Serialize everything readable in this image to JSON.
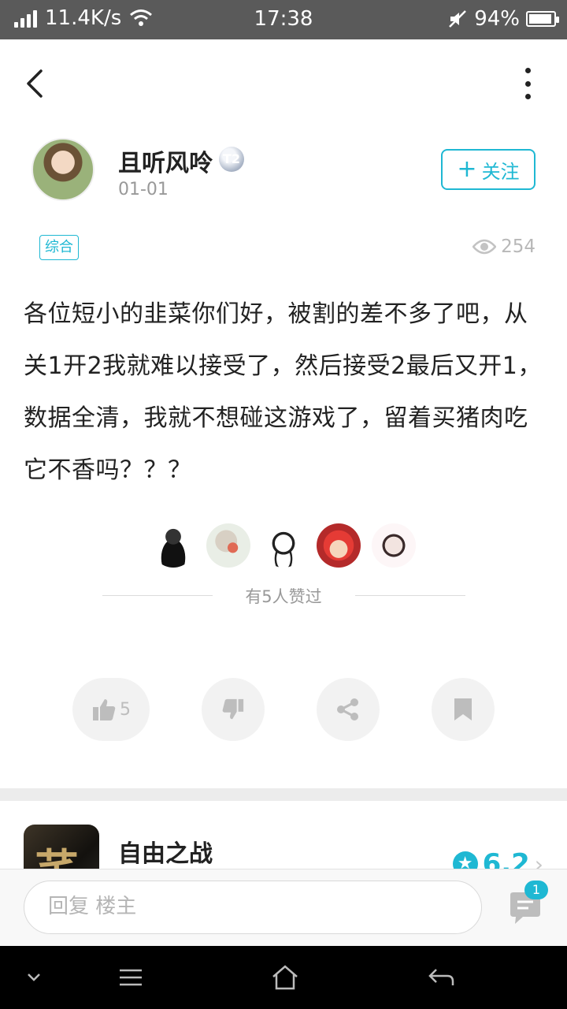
{
  "status_bar": {
    "network_speed": "11.4K/s",
    "time": "17:38",
    "battery_percent": "94%",
    "battery_level": 0.94
  },
  "author": {
    "name": "且听风呤",
    "level_badge": "T2",
    "date": "01-01",
    "follow_label": "关注",
    "follow_plus": "+"
  },
  "post": {
    "tag": "综合",
    "views": "254",
    "body": "各位短小的韭菜你们好，被割的差不多了吧，从关1开2我就难以接受了，然后接受2最后又开1，数据全清，我就不想碰这游戏了，留着买猪肉吃它不香吗？？？"
  },
  "likes": {
    "text": "有5人赞过",
    "count_label": "5"
  },
  "game": {
    "name": "自由之战",
    "score": "6.2"
  },
  "reply": {
    "placeholder": "回复  楼主",
    "comment_count": "1"
  },
  "colors": {
    "accent": "#1fb8d3",
    "status_bar_bg": "#5a5a5a",
    "divider": "#ececec"
  },
  "icons": [
    "back-arrow-icon",
    "more-vertical-icon",
    "eye-icon",
    "thumb-up-icon",
    "thumb-down-icon",
    "share-icon",
    "bookmark-icon",
    "star-icon",
    "chevron-right-icon",
    "comment-icon",
    "wifi-icon",
    "signal-icon",
    "mute-icon",
    "battery-icon"
  ]
}
